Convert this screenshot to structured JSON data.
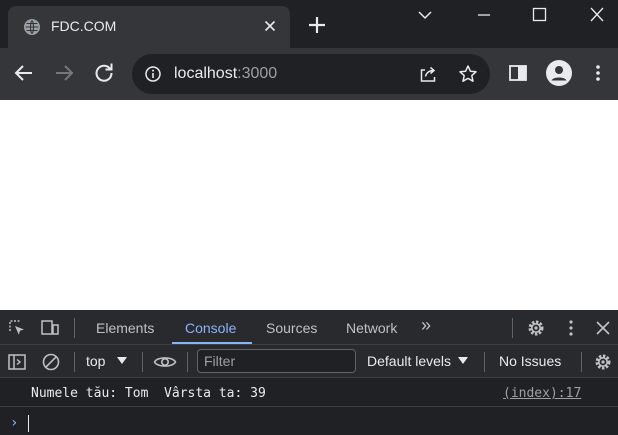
{
  "browser": {
    "tab": {
      "title": "FDC.COM"
    },
    "address_bar": {
      "host": "localhost",
      "port": ":3000"
    }
  },
  "devtools": {
    "tabs": [
      {
        "label": "Elements",
        "active": false
      },
      {
        "label": "Console",
        "active": true
      },
      {
        "label": "Sources",
        "active": false
      },
      {
        "label": "Network",
        "active": false
      }
    ],
    "more_tabs_glyph": "»",
    "console_toolbar": {
      "context": "top",
      "filter_placeholder": "Filter",
      "levels": "Default levels",
      "issues": "No Issues"
    },
    "console_messages": [
      {
        "text": "Numele tău: Tom  Vârsta ta: 39",
        "source": "(index):17"
      }
    ],
    "prompt_glyph": "›"
  },
  "colors": {
    "accent": "#8ab4f8",
    "toolbar": "#35363a",
    "frame": "#202124"
  }
}
